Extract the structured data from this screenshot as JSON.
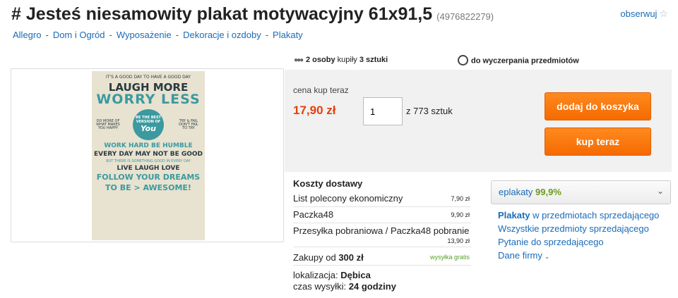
{
  "header": {
    "title": "# Jesteś niesamowity plakat motywacyjny 61x91,5",
    "item_id": "(4976822279)",
    "watch_label": "obserwuj",
    "watch_star": "☆"
  },
  "breadcrumb": {
    "separator": "-",
    "items": [
      "Allegro",
      "Dom i Ogród",
      "Wyposażenie",
      "Dekoracje i ozdoby",
      "Plakaty"
    ]
  },
  "poster": {
    "lines": [
      "IT'S A GOOD DAY TO HAVE A GOOD DAY",
      "LAUGH MORE",
      "WORRY LESS",
      "DO MORE OF WHAT MAKES YOU HAPPY",
      "TRY & FAIL DON'T FAIL TO TRY",
      "WORK HARD BE HUMBLE",
      "EVERY DAY MAY NOT BE GOOD",
      "BUT THERE IS SOMETHING GOOD IN EVERY DAY",
      "LIVE  LAUGH  LOVE",
      "FOLLOW YOUR DREAMS",
      "TO BE > AWESOME!"
    ],
    "circle_text": "BE THE BEST VERSION OF",
    "circle_you": "You"
  },
  "stats": {
    "people_icon": "people-icon",
    "buyers": "2 osoby",
    "bought_word": "kupiły",
    "pieces": "3 sztuki",
    "timer_icon": "stopwatch-icon",
    "timer_text": "do wyczerpania przedmiotów"
  },
  "buy": {
    "price_label": "cena kup teraz",
    "price": "17,90 zł",
    "quantity": "1",
    "stock": "z 773 sztuk",
    "add_to_cart": "dodaj do koszyka",
    "buy_now": "kup teraz"
  },
  "shipping": {
    "title": "Koszty dostawy",
    "options": [
      {
        "name": "List polecony ekonomiczny",
        "cost": "7,90 zł"
      },
      {
        "name": "Paczka48",
        "cost": "9,90 zł"
      },
      {
        "name": "Przesyłka pobraniowa / Paczka48 pobranie",
        "cost": "13,90 zł"
      }
    ],
    "free_prefix": "Zakupy od",
    "free_amount": "300 zł",
    "free_label": "wysyłka gratis",
    "location_label": "lokalizacja:",
    "location": "Dębica",
    "time_label": "czas wysyłki:",
    "time": "24 godziny"
  },
  "seller": {
    "name": "eplakaty",
    "rating": "99,9%",
    "links": {
      "category_bold": "Plakaty",
      "category_rest": "w przedmiotach sprzedającego",
      "all_items": "Wszystkie przedmioty sprzedającego",
      "ask": "Pytanie do sprzedającego",
      "company": "Dane firmy"
    }
  },
  "colors": {
    "link": "#1a6bb8",
    "price": "#e4400c",
    "button": "#ff7300",
    "rating": "#6a9b1f",
    "free_shipping": "#5aa02c"
  }
}
